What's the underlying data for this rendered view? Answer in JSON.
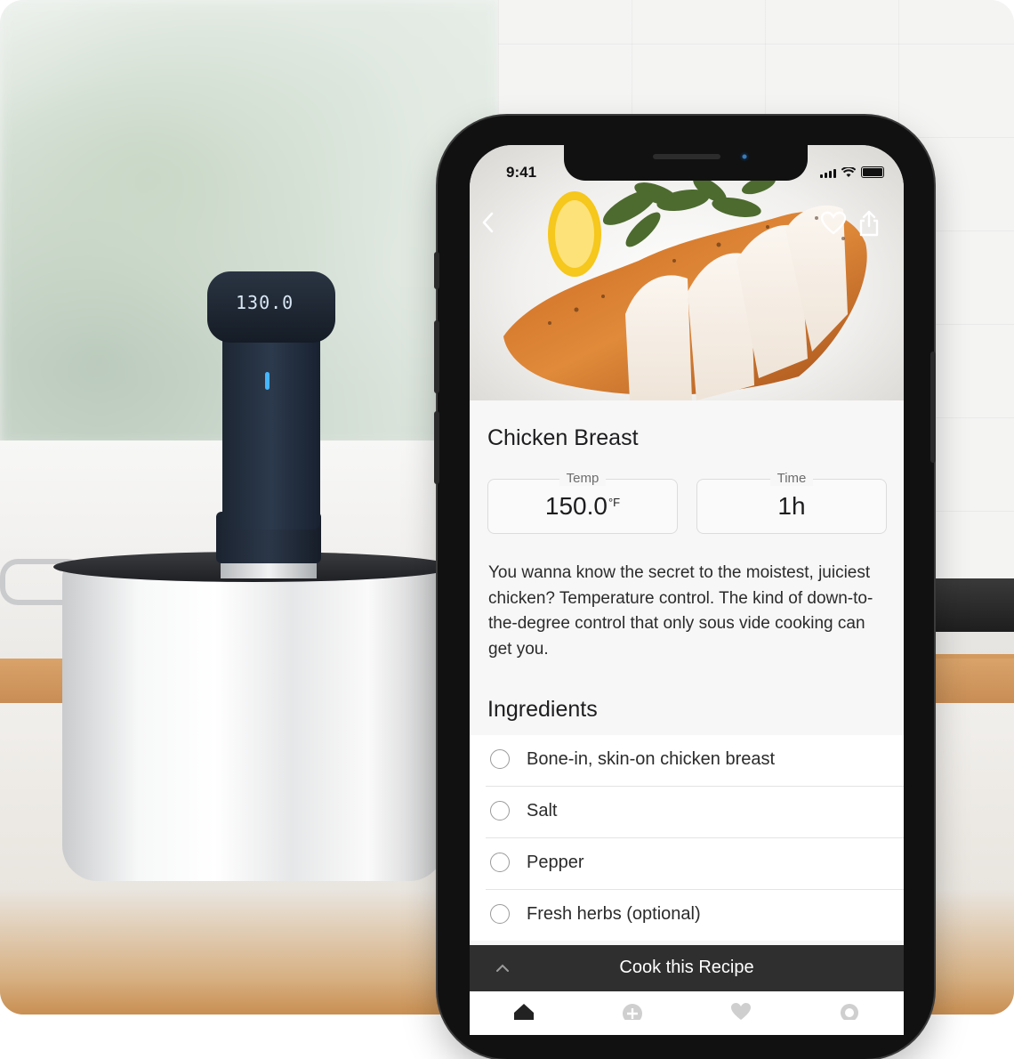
{
  "status_bar": {
    "time": "9:41"
  },
  "nav": {
    "back_icon": "chevron-left-icon",
    "favorite_icon": "heart-icon",
    "share_icon": "share-icon"
  },
  "device": {
    "display_reading": "130.0"
  },
  "recipe": {
    "title": "Chicken Breast",
    "temp": {
      "label": "Temp",
      "value": "150.0",
      "unit": "°F"
    },
    "time": {
      "label": "Time",
      "value": "1h"
    },
    "description": "You wanna know the secret to the moistest, juiciest chicken? Temperature control. The kind of down-to-the-degree control that only sous vide cooking can get you.",
    "ingredients_heading": "Ingredients",
    "ingredients": [
      {
        "label": "Bone-in, skin-on chicken breast",
        "checked": false
      },
      {
        "label": "Salt",
        "checked": false
      },
      {
        "label": "Pepper",
        "checked": false
      },
      {
        "label": "Fresh herbs (optional)",
        "checked": false
      }
    ]
  },
  "cook_bar": {
    "label": "Cook this Recipe",
    "icon": "chevron-up-icon"
  },
  "tabbar": {
    "icons": [
      "home-icon",
      "add-icon",
      "heart-icon",
      "chef-hat-icon"
    ]
  },
  "colors": {
    "cook_bar_bg": "#2f2f2f",
    "screen_bg": "#f7f7f7",
    "text": "#1d1d1f"
  }
}
